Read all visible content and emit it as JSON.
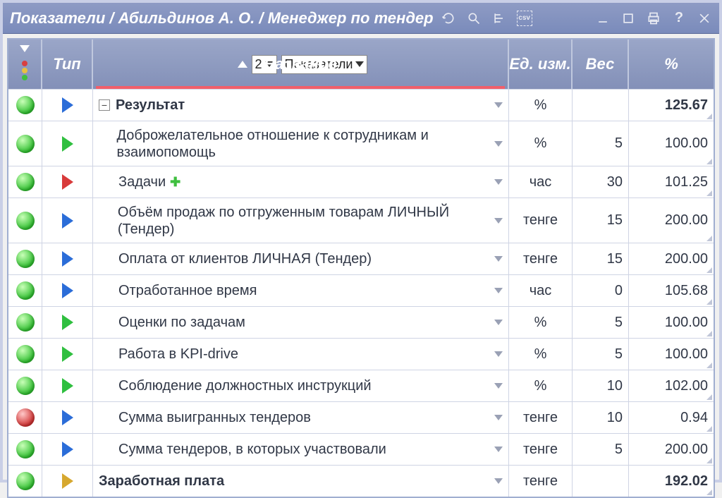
{
  "title": "Показатели / Абильдинов А. О. / Менеджер по тендер",
  "toolbar_icons": [
    "refresh",
    "search",
    "tree",
    "csv",
    "minimize",
    "maximize",
    "print",
    "help",
    "close"
  ],
  "headers": {
    "type": "Тип",
    "name": "Название",
    "unit": "Ед. изм.",
    "weight": "Вес",
    "percent": "%",
    "level_select": "2",
    "grouping_select": "Показатели"
  },
  "rows": [
    {
      "status": "green",
      "type": "blue",
      "collapse": "−",
      "name": "Результат",
      "bold": true,
      "unit": "%",
      "weight": "",
      "percent": "125.67",
      "tall": false,
      "plus": false,
      "indent": 0
    },
    {
      "status": "green",
      "type": "green",
      "name": "Доброжелательное отношение к сотрудникам и взаимопомощь",
      "unit": "%",
      "weight": "5",
      "percent": "100.00",
      "tall": true,
      "plus": false,
      "indent": 1
    },
    {
      "status": "green",
      "type": "red",
      "name": "Задачи",
      "unit": "час",
      "weight": "30",
      "percent": "101.25",
      "tall": false,
      "plus": true,
      "indent": 1
    },
    {
      "status": "green",
      "type": "blue",
      "name": "Объём продаж по отгруженным товарам ЛИЧНЫЙ (Тендер)",
      "unit": "тенге",
      "weight": "15",
      "percent": "200.00",
      "tall": true,
      "plus": false,
      "indent": 1
    },
    {
      "status": "green",
      "type": "blue",
      "name": "Оплата от клиентов ЛИЧНАЯ (Тендер)",
      "unit": "тенге",
      "weight": "15",
      "percent": "200.00",
      "tall": false,
      "plus": false,
      "indent": 1
    },
    {
      "status": "green",
      "type": "blue",
      "name": "Отработанное время",
      "unit": "час",
      "weight": "0",
      "percent": "105.68",
      "tall": false,
      "plus": false,
      "indent": 1
    },
    {
      "status": "green",
      "type": "green",
      "name": "Оценки по задачам",
      "unit": "%",
      "weight": "5",
      "percent": "100.00",
      "tall": false,
      "plus": false,
      "indent": 1
    },
    {
      "status": "green",
      "type": "green",
      "name": "Работа в KPI-drive",
      "unit": "%",
      "weight": "5",
      "percent": "100.00",
      "tall": false,
      "plus": false,
      "indent": 1
    },
    {
      "status": "green",
      "type": "green",
      "name": "Соблюдение должностных инструкций",
      "unit": "%",
      "weight": "10",
      "percent": "102.00",
      "tall": false,
      "plus": false,
      "indent": 1
    },
    {
      "status": "red",
      "type": "blue",
      "name": "Сумма выигранных тендеров",
      "unit": "тенге",
      "weight": "10",
      "percent": "0.94",
      "tall": false,
      "plus": false,
      "indent": 1
    },
    {
      "status": "green",
      "type": "blue",
      "name": "Сумма тендеров, в которых участвовали",
      "unit": "тенге",
      "weight": "5",
      "percent": "200.00",
      "tall": false,
      "plus": false,
      "indent": 1
    },
    {
      "status": "green",
      "type": "gold",
      "name": "Заработная плата",
      "bold": true,
      "unit": "тенге",
      "weight": "",
      "percent": "192.02",
      "tall": false,
      "plus": false,
      "indent": 0
    }
  ]
}
